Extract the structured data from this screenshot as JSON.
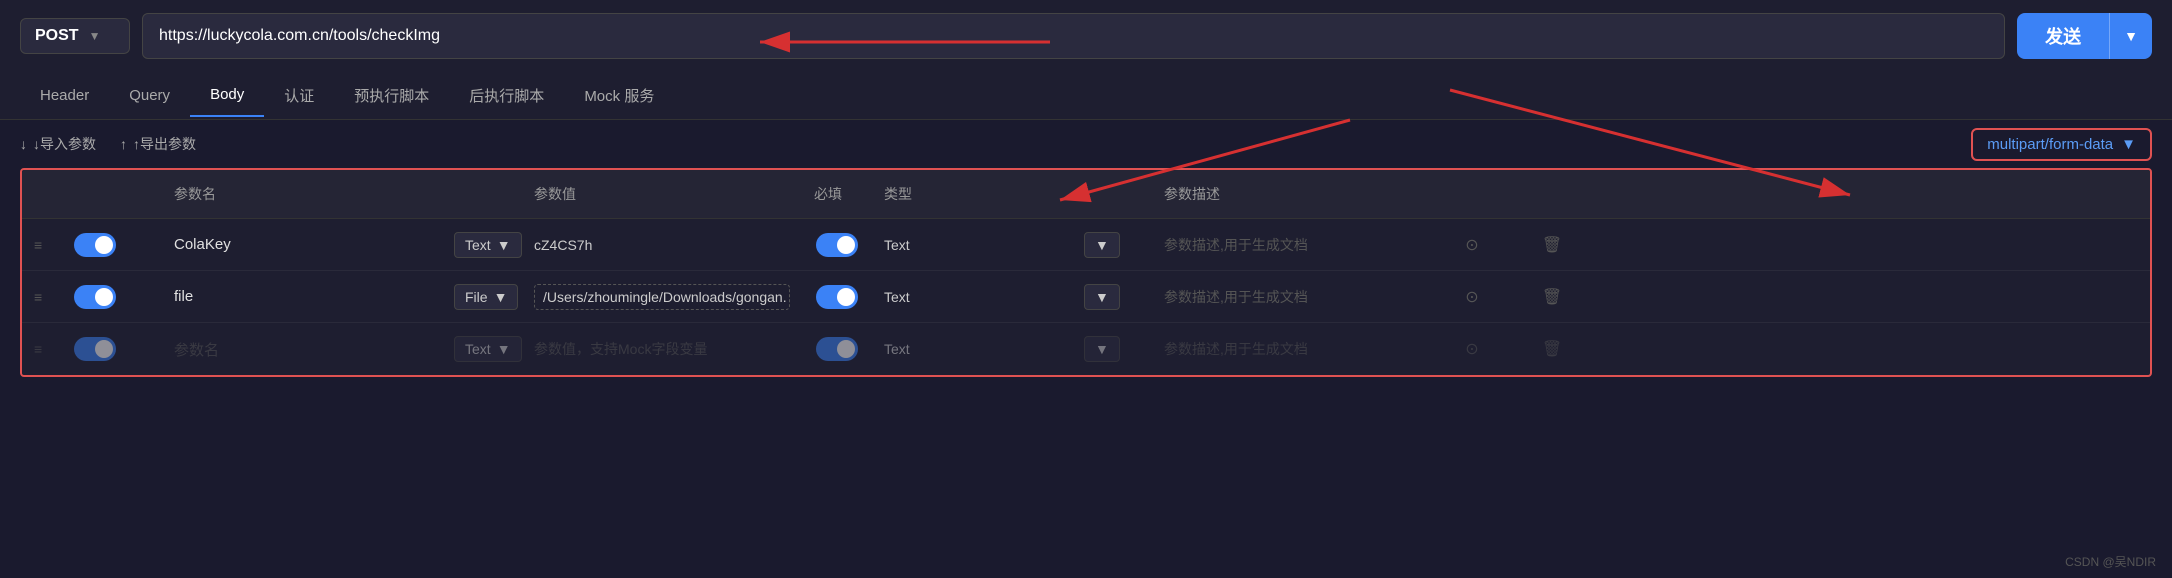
{
  "topbar": {
    "method": "POST",
    "method_chevron": "▼",
    "url": "https://luckycola.com.cn/tools/checkImg",
    "send_label": "发送",
    "send_chevron": "▼"
  },
  "tabs": [
    {
      "label": "Header",
      "active": false
    },
    {
      "label": "Query",
      "active": false
    },
    {
      "label": "Body",
      "active": true
    },
    {
      "label": "认证",
      "active": false
    },
    {
      "label": "预执行脚本",
      "active": false
    },
    {
      "label": "后执行脚本",
      "active": false
    },
    {
      "label": "Mock 服务",
      "active": false
    }
  ],
  "actions": {
    "import_label": "↓导入参数",
    "export_label": "↑导出参数",
    "content_type": "multipart/form-data",
    "content_type_chevron": "▼"
  },
  "table": {
    "headers": [
      "",
      "",
      "参数名",
      "",
      "参数值",
      "必填",
      "类型",
      "",
      "参数描述",
      "",
      ""
    ],
    "rows": [
      {
        "enabled": true,
        "param_name": "ColaKey",
        "type_label": "Text",
        "value": "cZ4CS7h",
        "required": true,
        "result_type": "Text",
        "desc_placeholder": "参数描述,用于生成文档",
        "is_placeholder": false
      },
      {
        "enabled": true,
        "param_name": "file",
        "type_label": "File",
        "value": "/Users/zhoumingle/Downloads/gongan.",
        "required": true,
        "result_type": "Text",
        "desc_placeholder": "参数描述,用于生成文档",
        "is_placeholder": false,
        "value_dashed": true
      },
      {
        "enabled": true,
        "param_name": "参数名",
        "type_label": "Text",
        "value": "参数值，支持Mock字段变量",
        "required": true,
        "result_type": "Text",
        "desc_placeholder": "参数描述,用于生成文档",
        "is_placeholder": true
      }
    ]
  },
  "watermark": "CSDN @吴NDIR"
}
